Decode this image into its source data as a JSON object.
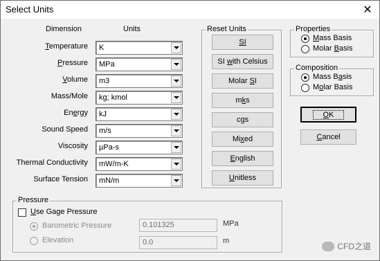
{
  "window": {
    "title": "Select Units",
    "close": "✕"
  },
  "headers": {
    "dimension": "Dimension",
    "units": "Units"
  },
  "rows": [
    {
      "pre": "",
      "key": "T",
      "post": "emperature",
      "value": "K"
    },
    {
      "pre": "",
      "key": "P",
      "post": "ressure",
      "value": "MPa"
    },
    {
      "pre": "",
      "key": "V",
      "post": "olume",
      "value": "m3"
    },
    {
      "pre": "Mass/Mole",
      "key": "",
      "post": "",
      "value": "kg; kmol"
    },
    {
      "pre": "En",
      "key": "e",
      "post": "rgy",
      "value": "kJ"
    },
    {
      "pre": "Sound Speed",
      "key": "",
      "post": "",
      "value": "m/s"
    },
    {
      "pre": "Viscosity",
      "key": "",
      "post": "",
      "value": "µPa-s"
    },
    {
      "pre": "Thermal Conductivity",
      "key": "",
      "post": "",
      "value": "mW/m-K"
    },
    {
      "pre": "Surface Tension",
      "key": "",
      "post": "",
      "value": "mN/m"
    }
  ],
  "reset": {
    "title": "Reset Units",
    "buttons": [
      {
        "pre": "",
        "key": "SI",
        "post": ""
      },
      {
        "pre": "SI ",
        "key": "w",
        "post": "ith Celsius"
      },
      {
        "pre": "Molar ",
        "key": "S",
        "post": "I"
      },
      {
        "pre": "m",
        "key": "k",
        "post": "s"
      },
      {
        "pre": "c",
        "key": "g",
        "post": "s"
      },
      {
        "pre": "Mi",
        "key": "x",
        "post": "ed"
      },
      {
        "pre": "",
        "key": "E",
        "post": "nglish"
      },
      {
        "pre": "",
        "key": "U",
        "post": "nitless"
      }
    ]
  },
  "properties": {
    "title": "Properties",
    "options": [
      {
        "pre": "",
        "key": "M",
        "post": "ass Basis",
        "checked": true
      },
      {
        "pre": "Molar ",
        "key": "B",
        "post": "asis",
        "checked": false
      }
    ]
  },
  "composition": {
    "title": "Composition",
    "options": [
      {
        "pre": "Mass B",
        "key": "a",
        "post": "sis",
        "checked": true
      },
      {
        "pre": "M",
        "key": "o",
        "post": "lar Basis",
        "checked": false
      }
    ]
  },
  "ok": {
    "key": "O",
    "post": "K"
  },
  "cancel": {
    "pre": "",
    "key": "C",
    "post": "ancel"
  },
  "pressure": {
    "title": "Pressure",
    "gage": {
      "pre": "",
      "key": "U",
      "post": "se Gage Pressure",
      "checked": false
    },
    "barometric": {
      "label": "Barometric Pressure",
      "value": "0.101325",
      "unit": "MPa"
    },
    "elevation": {
      "label": "Elevation",
      "value": "0.0",
      "unit": "m"
    }
  },
  "watermark": "CFD之道"
}
